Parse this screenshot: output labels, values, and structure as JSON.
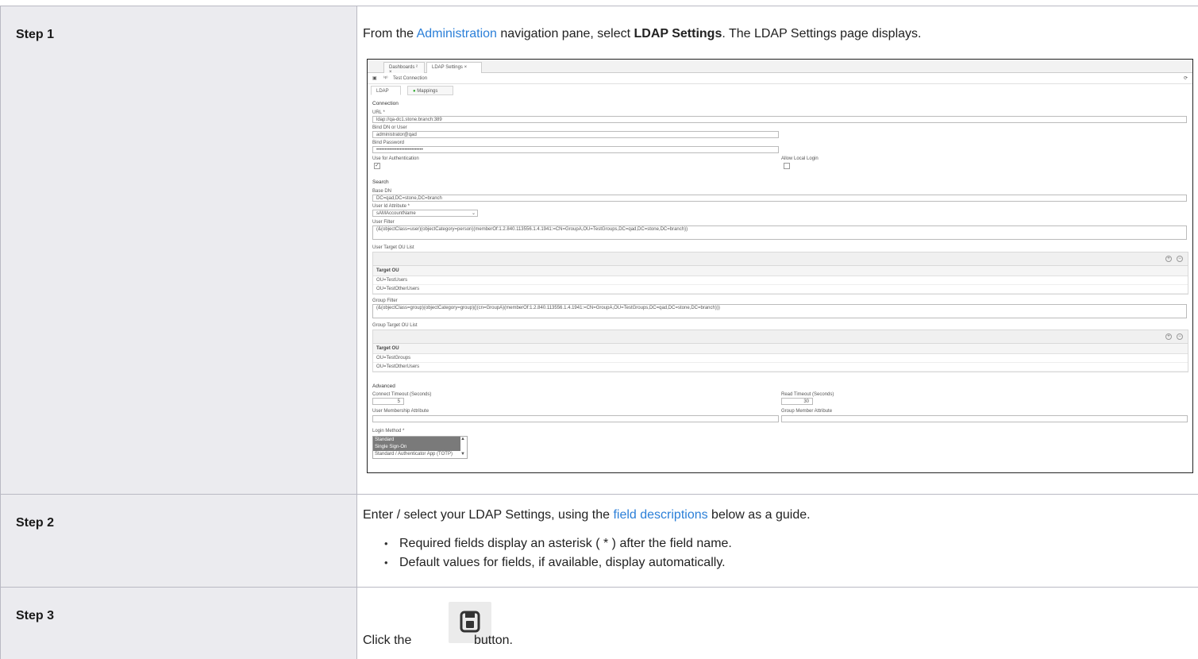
{
  "steps": [
    {
      "label": "Step 1",
      "text_before": "From the ",
      "link": "Administration",
      "text_mid": " navigation pane, select ",
      "bold": "LDAP Settings",
      "text_after": ". The LDAP Settings page displays."
    },
    {
      "label": "Step 2",
      "text_before": "Enter / select your LDAP Settings, using the ",
      "link": "field descriptions",
      "text_after": " below as a guide.",
      "bullets": [
        "Required fields display an asterisk ( * ) after the field name.",
        "Default values for fields, if available, display automatically."
      ]
    },
    {
      "label": "Step 3",
      "text_before": "Click the ",
      "text_after": " button.",
      "icon": "save-icon"
    }
  ],
  "screenshot": {
    "tabs": [
      "Dashboards ² ×",
      "LDAP Settings ×"
    ],
    "toolbar": {
      "test_connection": "Test Connection"
    },
    "subtabs": [
      "LDAP",
      "Mappings"
    ],
    "connection": {
      "heading": "Connection",
      "url_label": "URL *",
      "url_value": "ldap://qa-dc1.stone.branch:389",
      "bind_dn_label": "Bind DN or User",
      "bind_dn_value": "administrator@qad",
      "bind_password_label": "Bind Password",
      "bind_password_value": "••••••••••••••••••••••••••••",
      "use_auth_label": "Use for Authentication",
      "allow_local_label": "Allow Local Login"
    },
    "search": {
      "heading": "Search",
      "base_dn_label": "Base DN",
      "base_dn_value": "DC=qad,DC=stone,DC=branch",
      "user_id_label": "User Id Attribute *",
      "user_id_value": "sAMAccountName",
      "user_filter_label": "User Filter",
      "user_filter_value": "(&(objectClass=user)(objectCategory=person)(memberOf:1.2.840.113556.1.4.1941:=CN=GroupA,OU=TestGroups,DC=qad,DC=stone,DC=branch))",
      "user_ou_label": "User Target OU List",
      "user_ou_col": "Target OU",
      "user_ou_rows": [
        "OU=TestUsers",
        "OU=TestOtherUsers"
      ],
      "group_filter_label": "Group Filter",
      "group_filter_value": "(&(objectClass=group)(objectCategory=group)(|(cn=GroupA)(memberOf:1.2.840.113556.1.4.1941:=CN=GroupA,OU=TestGroups,DC=qad,DC=stone,DC=branch)))",
      "group_ou_label": "Group Target OU List",
      "group_ou_col": "Target OU",
      "group_ou_rows": [
        "OU=TestGroups",
        "OU=TestOtherUsers"
      ]
    },
    "advanced": {
      "heading": "Advanced",
      "connect_timeout_label": "Connect Timeout (Seconds)",
      "connect_timeout_value": "5",
      "read_timeout_label": "Read Timeout (Seconds)",
      "read_timeout_value": "30",
      "user_membership_label": "User Membership Attribute",
      "group_member_label": "Group Member Attribute",
      "login_method_label": "Login Method *",
      "login_methods": [
        "Standard",
        "Single Sign-On",
        "Standard / Authenticator App (TOTP)"
      ]
    }
  }
}
